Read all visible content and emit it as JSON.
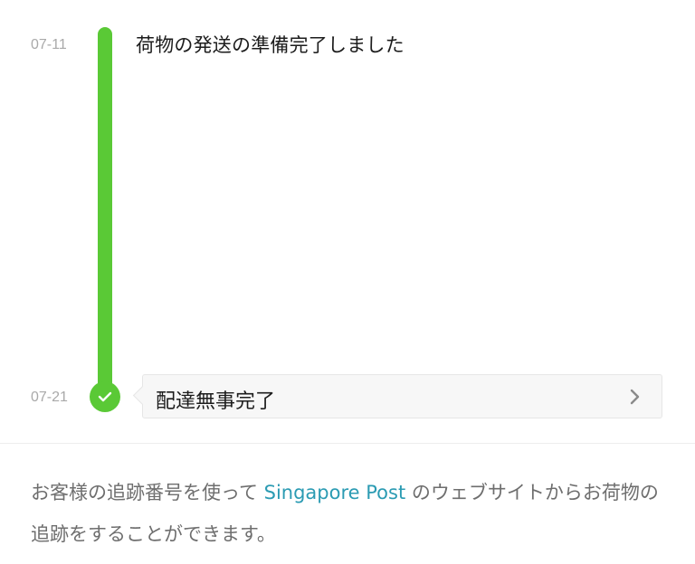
{
  "tracking": {
    "events": [
      {
        "date": "07-11",
        "text": "荷物の発送の準備完了しました"
      },
      {
        "date": "07-21",
        "text": "配達無事完了"
      }
    ],
    "colors": {
      "progress": "#5ac936",
      "link": "#2b9bb3",
      "date_text": "#a9a9a9"
    },
    "icons": {
      "status": "check-icon",
      "card_action": "chevron-right-icon"
    }
  },
  "footer": {
    "text_before": "お客様の追跡番号を使って ",
    "carrier_link": "Singapore Post",
    "text_after": " のウェブサイトからお荷物の追跡をすることができます。"
  }
}
